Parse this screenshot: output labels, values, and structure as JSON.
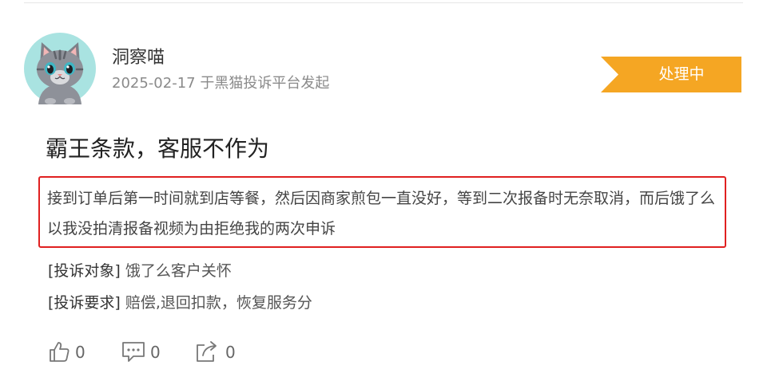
{
  "author": {
    "name": "洞察喵",
    "meta": "2025-02-17 于黑猫投诉平台发起"
  },
  "status": {
    "label": "处理中",
    "color": "#f5a623"
  },
  "complaint": {
    "title": "霸王条款，客服不作为",
    "content": "接到订单后第一时间就到店等餐，然后因商家煎包一直没好，等到二次报备时无奈取消，而后饿了么以我没拍清报备视频为由拒绝我的两次申诉",
    "highlight_color": "#e02020",
    "target_label": "[投诉对象]",
    "target_value": "饿了么客户关怀",
    "demand_label": "[投诉要求]",
    "demand_value": "赔偿,退回扣款，恢复服务分"
  },
  "actions": {
    "like_count": "0",
    "comment_count": "0",
    "share_count": "0"
  },
  "icons": {
    "avatar": "cat-avatar",
    "like": "thumbs-up-icon",
    "comment": "comment-icon",
    "share": "share-icon"
  }
}
